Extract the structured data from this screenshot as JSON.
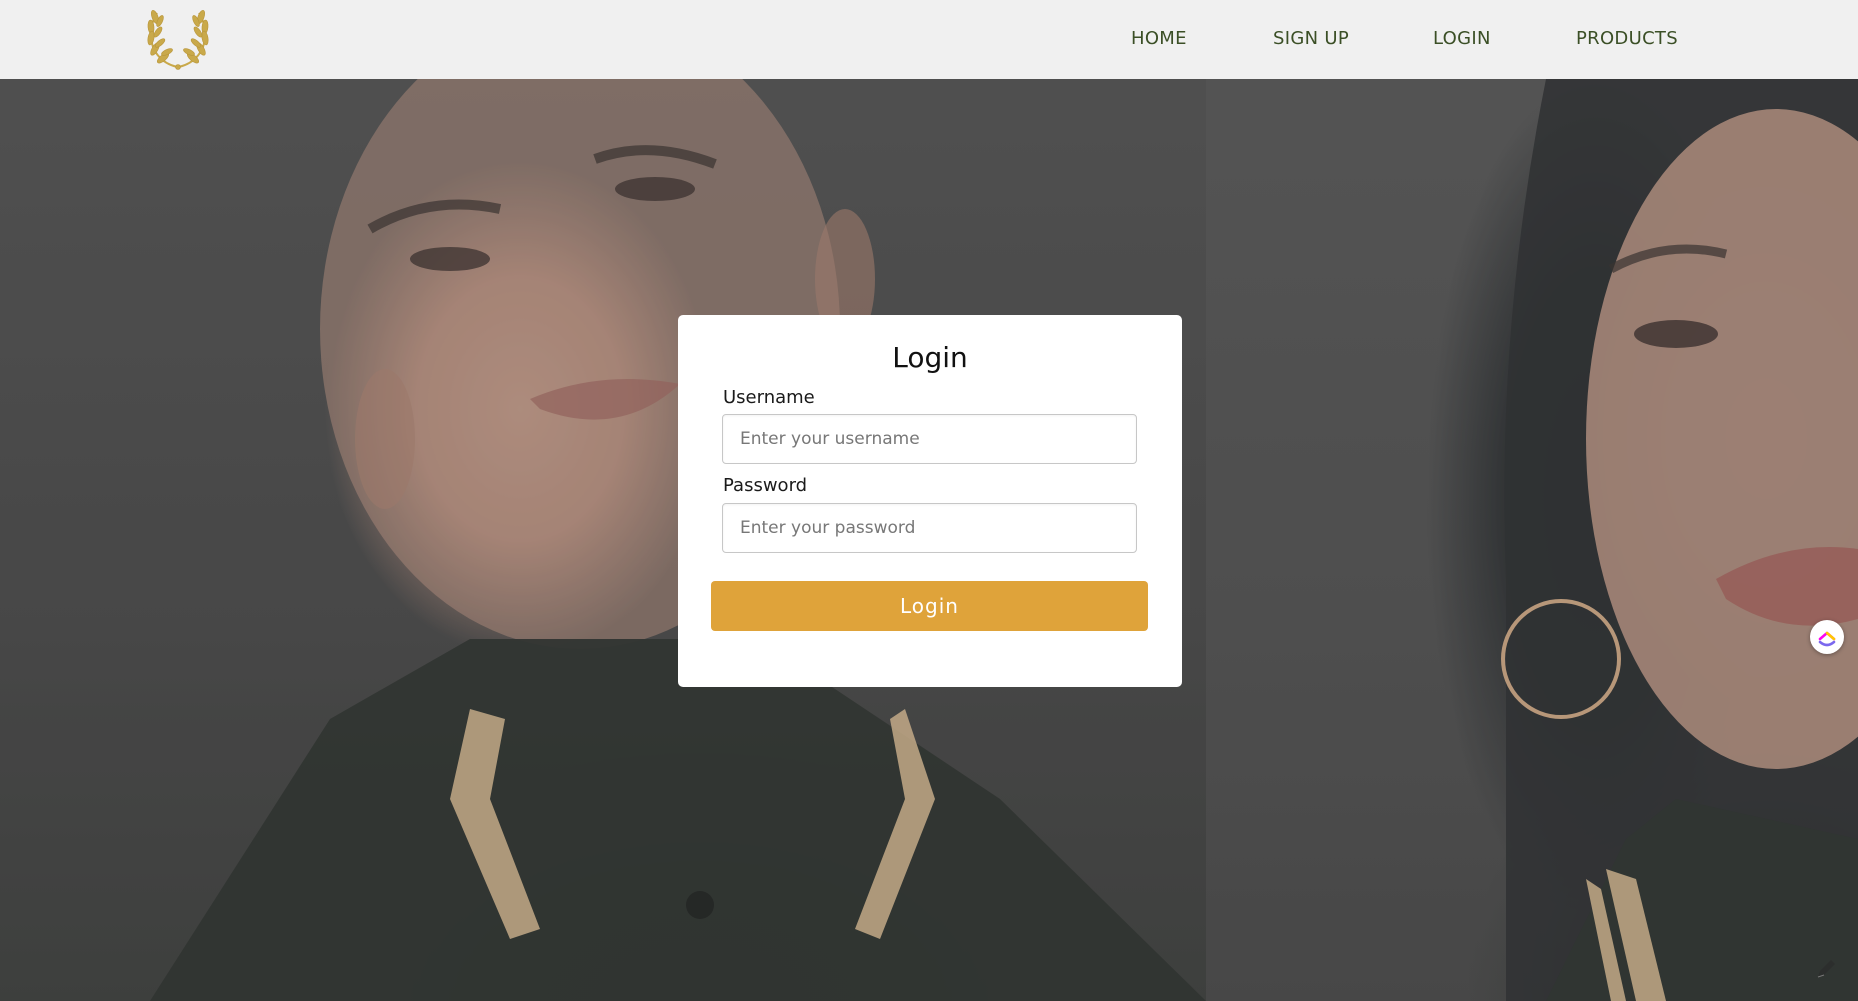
{
  "header": {
    "logo_icon": "laurel-wreath-icon",
    "nav": [
      {
        "label": "HOME"
      },
      {
        "label": "SIGN UP"
      },
      {
        "label": "LOGIN"
      },
      {
        "label": "PRODUCTS"
      }
    ]
  },
  "login_form": {
    "title": "Login",
    "username": {
      "label": "Username",
      "placeholder": "Enter your username",
      "value": ""
    },
    "password": {
      "label": "Password",
      "placeholder": "Enter your password",
      "value": ""
    },
    "submit_label": "Login"
  },
  "widgets": {
    "floating_button_icon": "clickup-logo-icon",
    "corner_icon": "pencil-icon"
  },
  "colors": {
    "header_bg": "#f0f0f0",
    "nav_text": "#3b4f26",
    "accent": "#dfa33a",
    "logo_gold": "#c9a94a",
    "card_bg": "#ffffff"
  }
}
